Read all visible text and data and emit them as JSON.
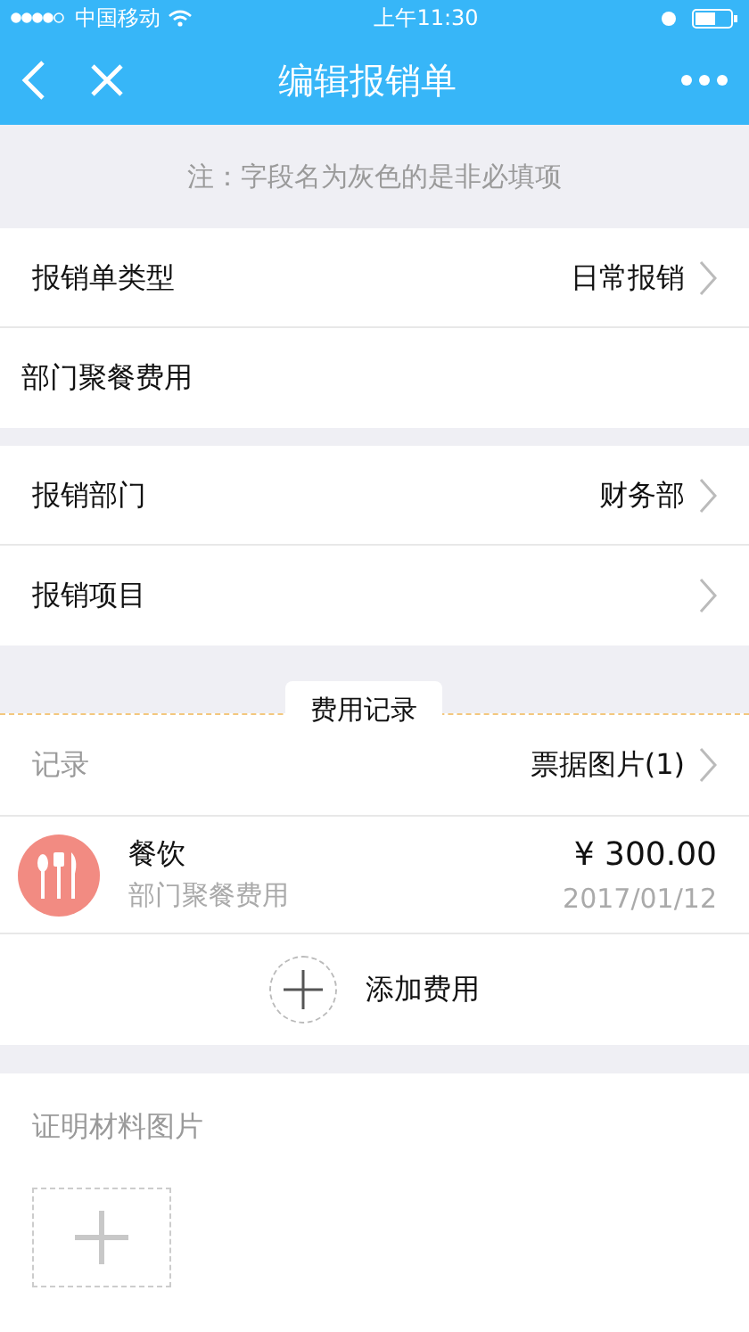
{
  "status_bar": {
    "carrier": "中国移动",
    "time": "上午11:30"
  },
  "nav": {
    "title": "编辑报销单"
  },
  "note": "注：字段名为灰色的是非必填项",
  "sections": [
    [
      {
        "kind": "select",
        "label": "报销单类型",
        "value": "日常报销",
        "optional": false
      },
      {
        "kind": "text",
        "value": "部门聚餐费用"
      }
    ],
    [
      {
        "kind": "select",
        "label": "报销部门",
        "value": "财务部",
        "optional": false
      },
      {
        "kind": "select",
        "label": "报销项目",
        "optional": false
      }
    ]
  ],
  "expenses": {
    "tab": "费用记录",
    "label": "记录",
    "label_optional": true,
    "receipts": "票据图片(1)",
    "items": [
      {
        "category": "餐饮",
        "note": "部门聚餐费用",
        "amount": "¥ 300.00",
        "date": "2017/01/12"
      }
    ],
    "add": "添加费用"
  },
  "proof": {
    "label": "证明材料图片",
    "optional": true
  }
}
